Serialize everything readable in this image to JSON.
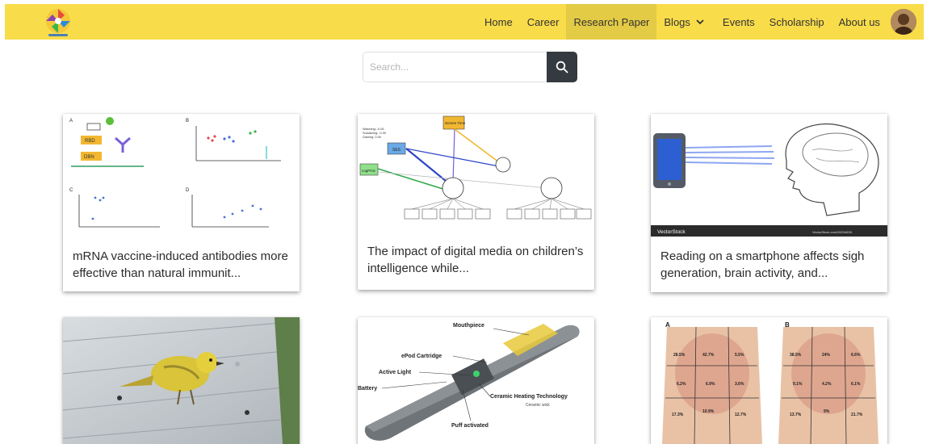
{
  "nav": {
    "items": [
      {
        "label": "Home",
        "active": false
      },
      {
        "label": "Career",
        "active": false
      },
      {
        "label": "Research Paper",
        "active": true
      },
      {
        "label": "Blogs",
        "active": false
      },
      {
        "label": "Events",
        "active": false
      },
      {
        "label": "Scholarship",
        "active": false
      },
      {
        "label": "About us",
        "active": false
      }
    ],
    "brand_color": "#f9dc4a",
    "active_color": "#e4cb45"
  },
  "search": {
    "placeholder": "Search...",
    "value": "",
    "button_color": "#343a40"
  },
  "cards": [
    {
      "title": "mRNA vaccine-induced antibodies more effective than natural immunit..."
    },
    {
      "title": "The impact of digital media on children’s intelligence while..."
    },
    {
      "title": "Reading on a smartphone affects sigh generation, brain activity, and..."
    },
    {
      "title": ""
    },
    {
      "title": ""
    },
    {
      "title": ""
    }
  ],
  "card_images": {
    "c1": {
      "panels": [
        "A",
        "B",
        "C",
        "D"
      ],
      "boxes": [
        "RBD",
        "DBN"
      ]
    },
    "c2": {
      "nodes": [
        "Screen Time",
        "SES",
        "cogPGS"
      ],
      "texts": [
        "Watching: -0.06",
        "Socializing: -0.09",
        "Gaming: 0.05"
      ]
    },
    "c3": {
      "watermark": "VectorStock",
      "url": "VectorStock.com/28234839"
    },
    "c5": {
      "labels": [
        "Mouthpiece",
        "ePod Cartridge",
        "Active Light",
        "Battery",
        "Ceramic Heating Technology",
        "Ceramic wick",
        "Puff activated"
      ]
    },
    "c6": {
      "panel_a": {
        "letter": "A",
        "values": [
          "28.5%",
          "42.7%",
          "5.5%",
          "6.2%",
          "6.9%",
          "3.6%",
          "17.3%",
          "10.9%",
          "12.7%"
        ]
      },
      "panel_b": {
        "letter": "B",
        "values": [
          "38.5%",
          "24%",
          "6.6%",
          "9.1%",
          "4.2%",
          "6.1%",
          "13.7%",
          "9%",
          "21.7%"
        ]
      }
    }
  }
}
